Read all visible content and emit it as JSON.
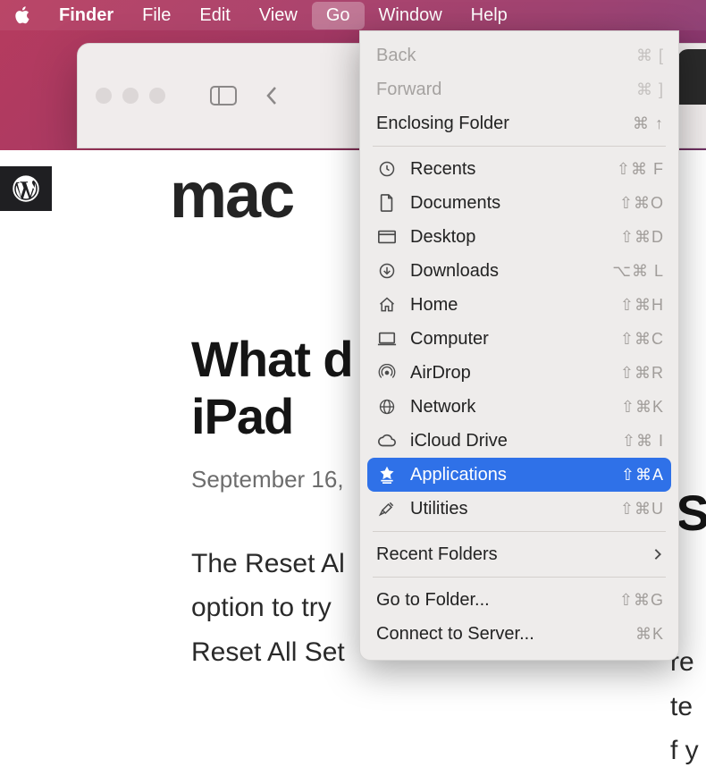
{
  "menubar": {
    "app": "Finder",
    "items": [
      "File",
      "Edit",
      "View",
      "Go",
      "Window",
      "Help"
    ],
    "active": "Go"
  },
  "dropdown": {
    "nav": [
      {
        "label": "Back",
        "shortcut": "⌘ [",
        "disabled": true
      },
      {
        "label": "Forward",
        "shortcut": "⌘ ]",
        "disabled": true
      },
      {
        "label": "Enclosing Folder",
        "shortcut": "⌘ ↑"
      }
    ],
    "locations": [
      {
        "icon": "recents",
        "label": "Recents",
        "shortcut": "⇧⌘ F"
      },
      {
        "icon": "documents",
        "label": "Documents",
        "shortcut": "⇧⌘O"
      },
      {
        "icon": "desktop",
        "label": "Desktop",
        "shortcut": "⇧⌘D"
      },
      {
        "icon": "downloads",
        "label": "Downloads",
        "shortcut": "⌥⌘ L"
      },
      {
        "icon": "home",
        "label": "Home",
        "shortcut": "⇧⌘H"
      },
      {
        "icon": "computer",
        "label": "Computer",
        "shortcut": "⇧⌘C"
      },
      {
        "icon": "airdrop",
        "label": "AirDrop",
        "shortcut": "⇧⌘R"
      },
      {
        "icon": "network",
        "label": "Network",
        "shortcut": "⇧⌘K"
      },
      {
        "icon": "icloud",
        "label": "iCloud Drive",
        "shortcut": "⇧⌘ I"
      },
      {
        "icon": "applications",
        "label": "Applications",
        "shortcut": "⇧⌘A",
        "highlighted": true
      },
      {
        "icon": "utilities",
        "label": "Utilities",
        "shortcut": "⇧⌘U"
      }
    ],
    "recentFolders": {
      "label": "Recent Folders"
    },
    "goto": [
      {
        "label": "Go to Folder...",
        "shortcut": "⇧⌘G"
      },
      {
        "label": "Connect to Server...",
        "shortcut": "⌘K"
      }
    ]
  },
  "page": {
    "logoPrefix": "mac",
    "title": "What does Reset All Settings do on iPad",
    "titleVisible1": "What d",
    "titleVisible2": "iPad",
    "date": "September 16,",
    "bodyLines": [
      "The Reset Al",
      "option to try",
      "Reset All Set"
    ],
    "rightTitleSnippet": "S",
    "rightBodyLines": [
      "re",
      "te",
      "f y"
    ]
  }
}
